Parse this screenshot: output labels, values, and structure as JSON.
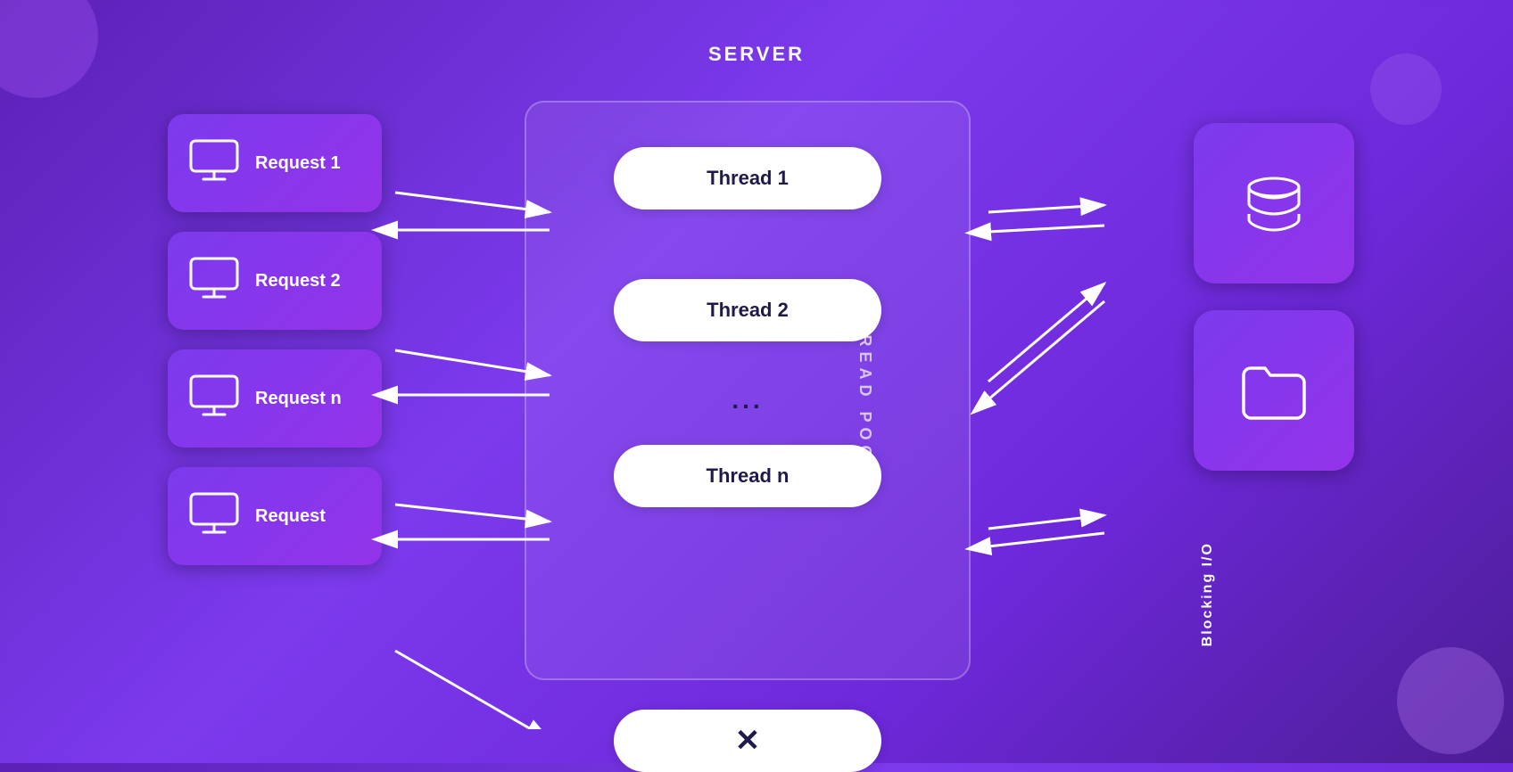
{
  "title": "SERVER",
  "requests": [
    {
      "id": "req1",
      "label": "Request 1"
    },
    {
      "id": "req2",
      "label": "Request 2"
    },
    {
      "id": "reqn",
      "label": "Request n"
    },
    {
      "id": "req",
      "label": "Request"
    }
  ],
  "threads": [
    {
      "id": "t1",
      "label": "Thread 1"
    },
    {
      "id": "t2",
      "label": "Thread 2"
    },
    {
      "id": "tn",
      "label": "Thread n"
    }
  ],
  "thread_pool_label": "THREAD POOL",
  "dots": "...",
  "rejected_symbol": "✕",
  "blocking_io_label": "Blocking I/O",
  "resources": [
    {
      "id": "db",
      "type": "database"
    },
    {
      "id": "folder",
      "type": "folder"
    }
  ],
  "colors": {
    "card_bg_start": "#7c3aed",
    "card_bg_end": "#9333ea",
    "thread_pill_bg": "#ffffff",
    "thread_text": "#1e1b4b",
    "arrow": "#ffffff",
    "bg_start": "#5b21b6",
    "bg_end": "#4c1d95"
  }
}
